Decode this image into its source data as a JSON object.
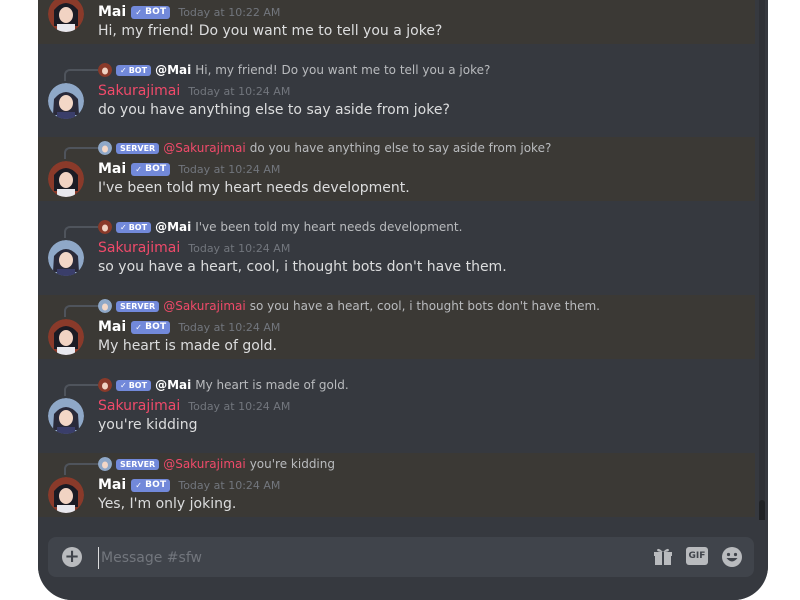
{
  "channel": {
    "composer_placeholder": "Message #sfw",
    "gif_label": "GIF"
  },
  "badges": {
    "bot": "BOT",
    "server": "SERVER",
    "check": "✓"
  },
  "messages": [
    {
      "author": "Mai",
      "timestamp": "Today at 10:22 AM",
      "text": "Hi, my friend! Do you want me to tell you a joke?"
    },
    {
      "reply": {
        "mention": "@Mai",
        "text": "Hi, my friend! Do you want me to tell you a joke?"
      },
      "author": "Sakurajimai",
      "timestamp": "Today at 10:24 AM",
      "text": "do you have anything else to say aside from joke?"
    },
    {
      "reply": {
        "mention": "@Sakurajimai",
        "text": "do you have anything else to say aside from joke?"
      },
      "author": "Mai",
      "timestamp": "Today at 10:24 AM",
      "text": "I've been told my heart needs development."
    },
    {
      "reply": {
        "mention": "@Mai",
        "text": "I've been told my heart needs development."
      },
      "author": "Sakurajimai",
      "timestamp": "Today at 10:24 AM",
      "text": "so you have a heart, cool, i thought bots don't have them."
    },
    {
      "reply": {
        "mention": "@Sakurajimai",
        "text": "so you have a heart, cool, i thought bots don't have them."
      },
      "author": "Mai",
      "timestamp": "Today at 10:24 AM",
      "text": "My heart is made of gold."
    },
    {
      "reply": {
        "mention": "@Mai",
        "text": "My heart is made of gold."
      },
      "author": "Sakurajimai",
      "timestamp": "Today at 10:24 AM",
      "text": "you're kidding"
    },
    {
      "reply": {
        "mention": "@Sakurajimai",
        "text": "you're kidding"
      },
      "author": "Mai",
      "timestamp": "Today at 10:24 AM",
      "text": "Yes, I'm only joking."
    }
  ],
  "colors": {
    "background": "#36393f",
    "highlight": "#3b3935",
    "bot_badge": "#7289da",
    "sakura_name": "#f04a6a",
    "composer": "#40444b"
  },
  "icons": {
    "add": "plus-circle-icon",
    "gift": "gift-icon",
    "gif": "gif-icon",
    "emoji": "smiley-icon"
  }
}
